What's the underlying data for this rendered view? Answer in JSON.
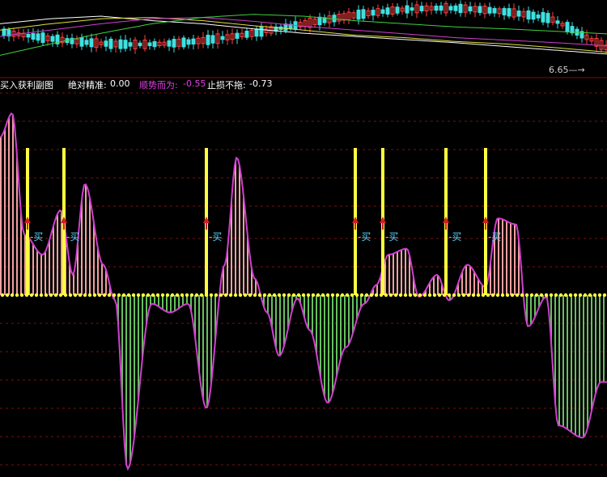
{
  "window": {
    "indicator_name": "买入获利副图",
    "params": [
      {
        "label": "绝对精准:",
        "value": "0.00",
        "color": "#ffffff"
      },
      {
        "label": "顺势而为:",
        "value": "-0.55",
        "color": "#e040e0"
      },
      {
        "label": "止损不拖:",
        "value": "-0.73",
        "color": "#ffffff"
      }
    ],
    "price_marker": "6.65"
  },
  "colors": {
    "positive_bar": "#f0a0a0",
    "negative_bar": "#66c060",
    "curve": "#d040d0",
    "zero_dots": "#ffff40",
    "signal_line": "#ffff40",
    "buy_text": "#55d7ff",
    "arrow": "#d02020",
    "grid": "#7a1010",
    "price_up": "#ff4040",
    "price_down": "#40e0e0",
    "ma_white": "#ffffff",
    "ma_yellow": "#e0e040",
    "ma_purple": "#d040d0",
    "ma_green": "#40d040"
  },
  "chart_data": [
    {
      "type": "bar",
      "name": "main_oscillator",
      "ylim": [
        -1.0,
        1.0
      ],
      "grid": true,
      "curve_points": [
        [
          0,
          0.78
        ],
        [
          0.02,
          0.9
        ],
        [
          0.04,
          0.3
        ],
        [
          0.07,
          0.2
        ],
        [
          0.1,
          0.42
        ],
        [
          0.12,
          0.1
        ],
        [
          0.14,
          0.55
        ],
        [
          0.17,
          0.15
        ],
        [
          0.19,
          -0.03
        ],
        [
          0.21,
          -1.0
        ],
        [
          0.25,
          -0.05
        ],
        [
          0.28,
          -0.1
        ],
        [
          0.31,
          -0.05
        ],
        [
          0.34,
          -0.65
        ],
        [
          0.37,
          0.15
        ],
        [
          0.39,
          0.68
        ],
        [
          0.42,
          0.08
        ],
        [
          0.44,
          -0.1
        ],
        [
          0.46,
          -0.35
        ],
        [
          0.49,
          -0.02
        ],
        [
          0.51,
          -0.2
        ],
        [
          0.54,
          -0.62
        ],
        [
          0.57,
          -0.3
        ],
        [
          0.6,
          -0.05
        ],
        [
          0.62,
          0.05
        ],
        [
          0.64,
          0.2
        ],
        [
          0.67,
          0.23
        ],
        [
          0.69,
          -0.01
        ],
        [
          0.72,
          0.1
        ],
        [
          0.74,
          -0.03
        ],
        [
          0.77,
          0.15
        ],
        [
          0.8,
          0.04
        ],
        [
          0.82,
          0.38
        ],
        [
          0.85,
          0.35
        ],
        [
          0.87,
          -0.18
        ],
        [
          0.9,
          -0.01
        ],
        [
          0.92,
          -0.75
        ],
        [
          0.96,
          -0.82
        ],
        [
          0.99,
          -0.5
        ]
      ],
      "signals_at": [
        0.045,
        0.105,
        0.34,
        0.585,
        0.63,
        0.735,
        0.8
      ],
      "signal_label": "买"
    },
    {
      "type": "line",
      "name": "top_price_panel",
      "series": [
        {
          "color_key": "ma_white",
          "values": [
            0.3,
            0.22,
            0.18,
            0.25,
            0.3,
            0.38,
            0.45,
            0.5,
            0.55,
            0.6,
            0.66,
            0.72,
            0.78
          ]
        },
        {
          "color_key": "ma_yellow",
          "values": [
            0.4,
            0.3,
            0.22,
            0.2,
            0.25,
            0.33,
            0.4,
            0.48,
            0.52,
            0.58,
            0.62,
            0.68,
            0.75
          ]
        },
        {
          "color_key": "ma_purple",
          "values": [
            0.5,
            0.4,
            0.3,
            0.22,
            0.2,
            0.26,
            0.34,
            0.4,
            0.46,
            0.52,
            0.56,
            0.6,
            0.65
          ]
        },
        {
          "color_key": "ma_green",
          "values": [
            0.8,
            0.62,
            0.45,
            0.3,
            0.2,
            0.15,
            0.18,
            0.25,
            0.3,
            0.35,
            0.38,
            0.42,
            0.46
          ]
        }
      ]
    }
  ]
}
